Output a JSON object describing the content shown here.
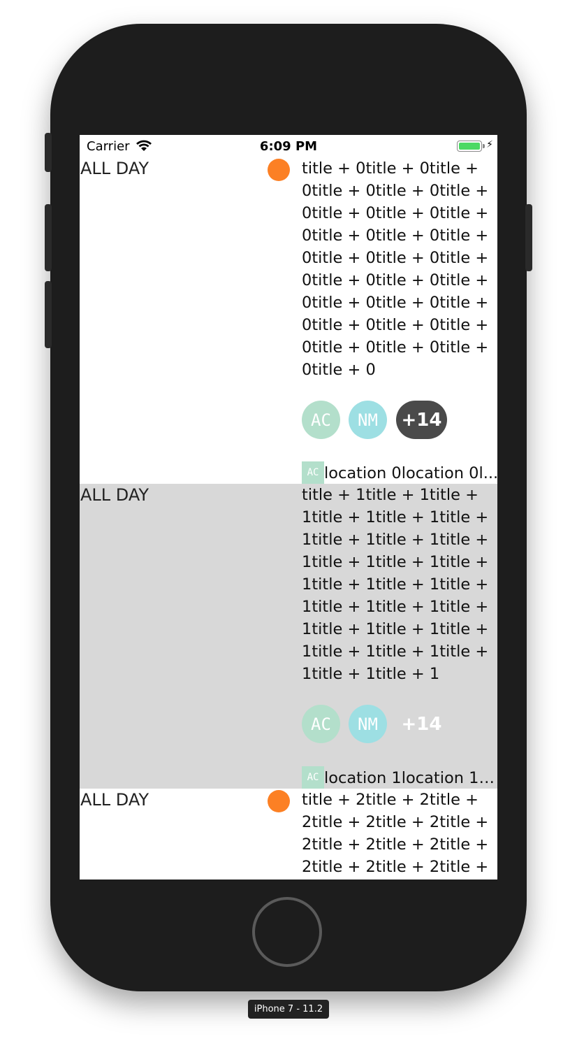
{
  "status_bar": {
    "carrier": "Carrier",
    "time": "6:09 PM"
  },
  "events": [
    {
      "allday_label": "ALL DAY",
      "has_dot": true,
      "dot_color": "#fc8024",
      "title": "title + 0title + 0title + 0title + 0title + 0title + 0title + 0title + 0title + 0title + 0title + 0title + 0title + 0title + 0title + 0title + 0title + 0title + 0title + 0title + 0title + 0title + 0title + 0title + 0title + 0title + 0title + 0title + 0",
      "avatars": [
        "AC",
        "NM"
      ],
      "more_label": "+14",
      "location_thumb": "AC",
      "location": "location 0location 0l..."
    },
    {
      "allday_label": "ALL DAY",
      "has_dot": false,
      "title": "title + 1title + 1title + 1title + 1title + 1title + 1title + 1title + 1title + 1title + 1title + 1title + 1title + 1title + 1title + 1title + 1title + 1title + 1title + 1title + 1title + 1title + 1title + 1title + 1title + 1title + 1",
      "avatars": [
        "AC",
        "NM"
      ],
      "more_label": "+14",
      "location_thumb": "AC",
      "location": "location 1location 1lo..."
    },
    {
      "allday_label": "ALL DAY",
      "has_dot": true,
      "dot_color": "#fc8024",
      "title": "title + 2title + 2title + 2title + 2title + 2title + 2title + 2title + 2title + 2title + 2title + 2title +"
    }
  ],
  "device_label": "iPhone 7 - 11.2"
}
